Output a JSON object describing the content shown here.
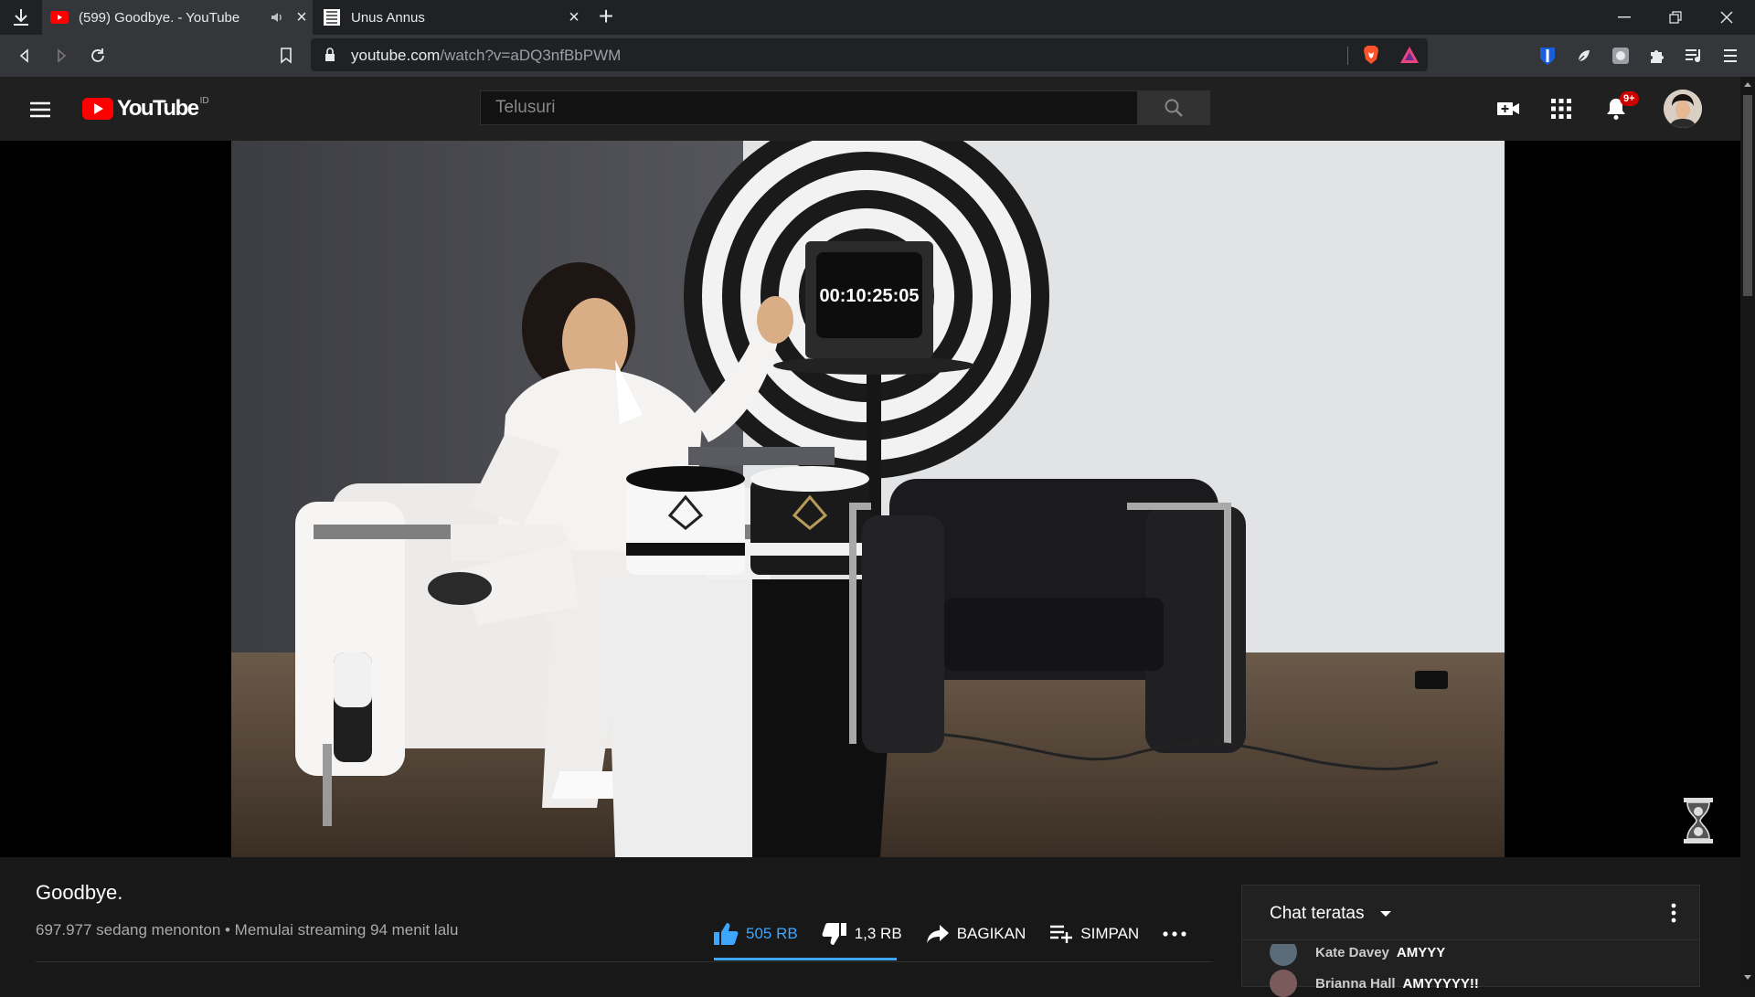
{
  "browser": {
    "tabs": [
      {
        "title": "(599) Goodbye. - YouTube",
        "active": true,
        "favicon": "youtube-icon",
        "audio": true
      },
      {
        "title": "Unus Annus",
        "active": false,
        "favicon": "unus-annus-icon"
      }
    ],
    "url_domain": "youtube.com",
    "url_path": "/watch?v=aDQ3nfBbPWM"
  },
  "youtube": {
    "region": "ID",
    "search_placeholder": "Telusuri",
    "notification_count": "9+"
  },
  "video": {
    "tv_countdown": "00:10:25:05",
    "title": "Goodbye.",
    "meta": "697.977 sedang menonton • Memulai streaming 94 menit lalu",
    "likes": "505 RB",
    "dislikes": "1,3 RB",
    "like_ratio": 1.0,
    "share_label": "BAGIKAN",
    "save_label": "SIMPAN"
  },
  "chat": {
    "title": "Chat teratas",
    "messages": [
      {
        "author": "Kate Davey",
        "text": "AMYYY"
      },
      {
        "author": "Brianna Hall",
        "text": "AMYYYYY!!"
      }
    ]
  },
  "colors": {
    "accent": "#3ea6ff",
    "brand_red": "#ff0000",
    "badge": "#cc0000"
  }
}
